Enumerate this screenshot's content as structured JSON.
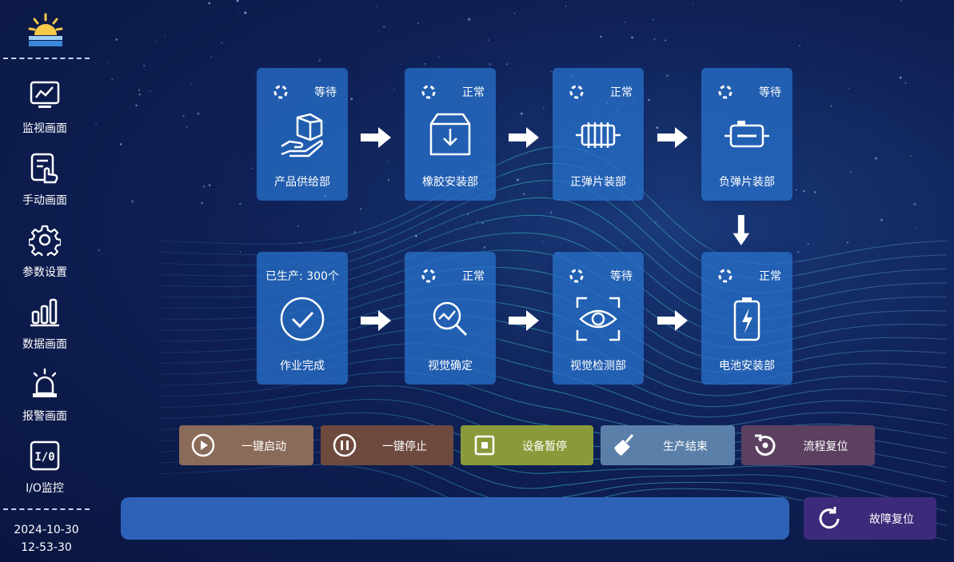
{
  "sidebar": {
    "logo_icon": "sunrise-logo",
    "items": [
      {
        "label": "监视画面",
        "icon": "monitor-chart-icon"
      },
      {
        "label": "手动画面",
        "icon": "hand-tap-icon"
      },
      {
        "label": "参数设置",
        "icon": "gear-icon"
      },
      {
        "label": "数据画面",
        "icon": "bar-chart-icon"
      },
      {
        "label": "报警画面",
        "icon": "alarm-beacon-icon"
      },
      {
        "label": "I/O监控",
        "icon": "io-icon"
      }
    ],
    "date": "2024-10-30",
    "time": "12-53-30"
  },
  "stations": {
    "product_supply": {
      "status": "等待",
      "name": "产品供给部",
      "icon": "box-hand-icon"
    },
    "rubber_install": {
      "status": "正常",
      "name": "橡胶安装部",
      "icon": "download-box-icon"
    },
    "positive_spring": {
      "status": "正常",
      "name": "正弹片装部",
      "icon": "spring-coil-icon"
    },
    "negative_spring": {
      "status": "等待",
      "name": "负弹片装部",
      "icon": "battery-clip-icon"
    },
    "job_done": {
      "count_label": "已生产: 300个",
      "name": "作业完成",
      "icon": "check-circle-icon"
    },
    "vision_confirm": {
      "status": "正常",
      "name": "视觉确定",
      "icon": "search-chart-icon"
    },
    "vision_inspect": {
      "status": "等待",
      "name": "视觉检测部",
      "icon": "eye-scan-icon"
    },
    "battery_install": {
      "status": "正常",
      "name": "电池安装部",
      "icon": "battery-bolt-icon"
    }
  },
  "controls": {
    "start": {
      "label": "一键启动",
      "icon": "play-icon",
      "color": "#8a6a58"
    },
    "stop": {
      "label": "一键停止",
      "icon": "pause-icon",
      "color": "#6e4a3e"
    },
    "pause": {
      "label": "设备暂停",
      "icon": "stop-square-icon",
      "color": "#8a9a3a"
    },
    "end": {
      "label": "生产结束",
      "icon": "broom-icon",
      "color": "#5a7fa8"
    },
    "reset": {
      "label": "流程复位",
      "icon": "reset-icon",
      "color": "#5b4060"
    }
  },
  "fault_reset": {
    "label": "故障复位",
    "icon": "refresh-icon"
  },
  "colors": {
    "background": "#0f2055",
    "card": "#266ec8",
    "progress": "#2e62b8",
    "fault_button": "#3d2a7a"
  }
}
